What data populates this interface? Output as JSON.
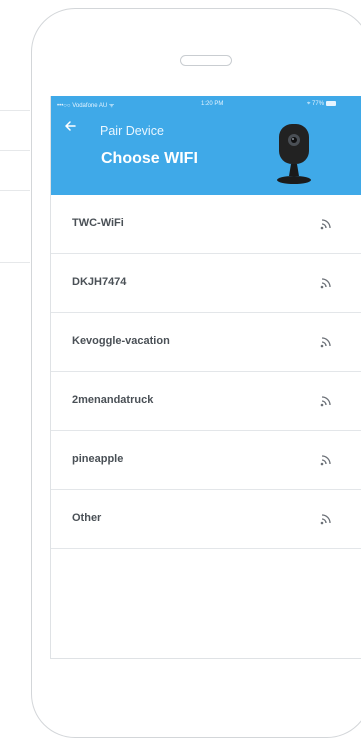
{
  "status_bar": {
    "carrier": "•••○○ Vodafone AU ᯤ",
    "time": "1:20 PM",
    "battery": "⌖ 77%"
  },
  "header": {
    "back_icon": "back-arrow-icon",
    "nav_title": "Pair Device",
    "page_title": "Choose WIFI",
    "illustration": "security-camera-icon",
    "color": "#3fa9e8"
  },
  "wifi_networks": [
    {
      "name": "TWC-WiFi",
      "icon": "wifi-signal-icon"
    },
    {
      "name": "DKJH7474",
      "icon": "wifi-signal-icon"
    },
    {
      "name": "Kevoggle-vacation",
      "icon": "wifi-signal-icon"
    },
    {
      "name": "2menandatruck",
      "icon": "wifi-signal-icon"
    },
    {
      "name": "pineapple",
      "icon": "wifi-signal-icon"
    },
    {
      "name": "Other",
      "icon": "wifi-signal-icon"
    }
  ]
}
